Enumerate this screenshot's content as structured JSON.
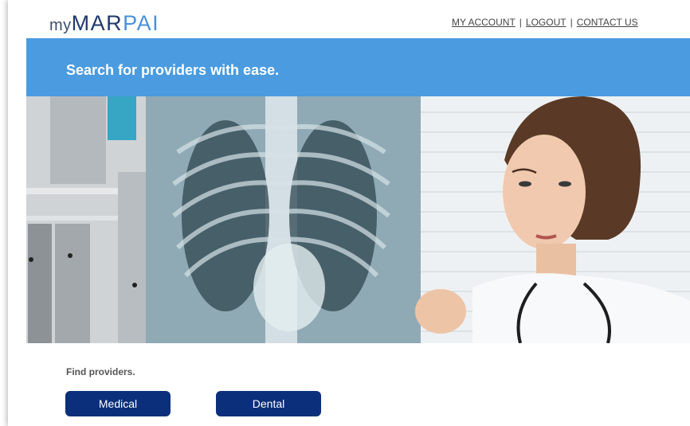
{
  "header": {
    "logo_prefix": "my",
    "logo_brand_part1": "MAR",
    "logo_brand_part2": "PAI",
    "links": {
      "my_account": "MY ACCOUNT",
      "logout": "LOGOUT",
      "contact_us": "CONTACT US",
      "separator": "|"
    }
  },
  "banner": {
    "title": "Search for providers with ease."
  },
  "hero": {
    "image_icon": "doctor-xray-photo"
  },
  "find": {
    "label": "Find providers.",
    "medical_button": "Medical",
    "dental_button": "Dental"
  },
  "colors": {
    "banner": "#4a9be0",
    "button": "#0b2f7a",
    "logo_dark": "#1f3a6e",
    "logo_accent": "#4a90d9"
  }
}
